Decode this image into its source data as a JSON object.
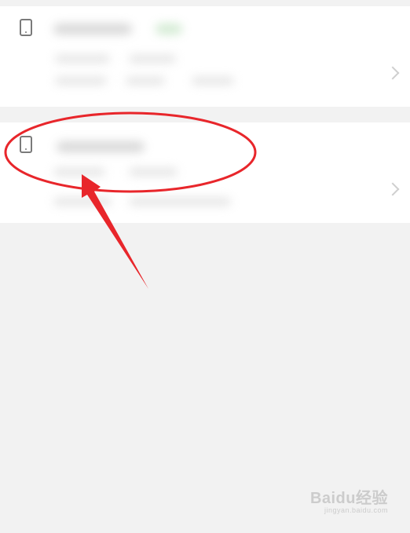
{
  "watermark": {
    "brand": "Baidu经验",
    "sub": "jingyan.baidu.com"
  },
  "colors": {
    "background": "#f2f2f2",
    "card": "#ffffff",
    "annotation": "#e8262b",
    "device_icon": "#7a7a7a",
    "chevron": "#cfcfcf"
  },
  "icons": {
    "device": "phone-icon",
    "chevron": "chevron-right-icon"
  }
}
